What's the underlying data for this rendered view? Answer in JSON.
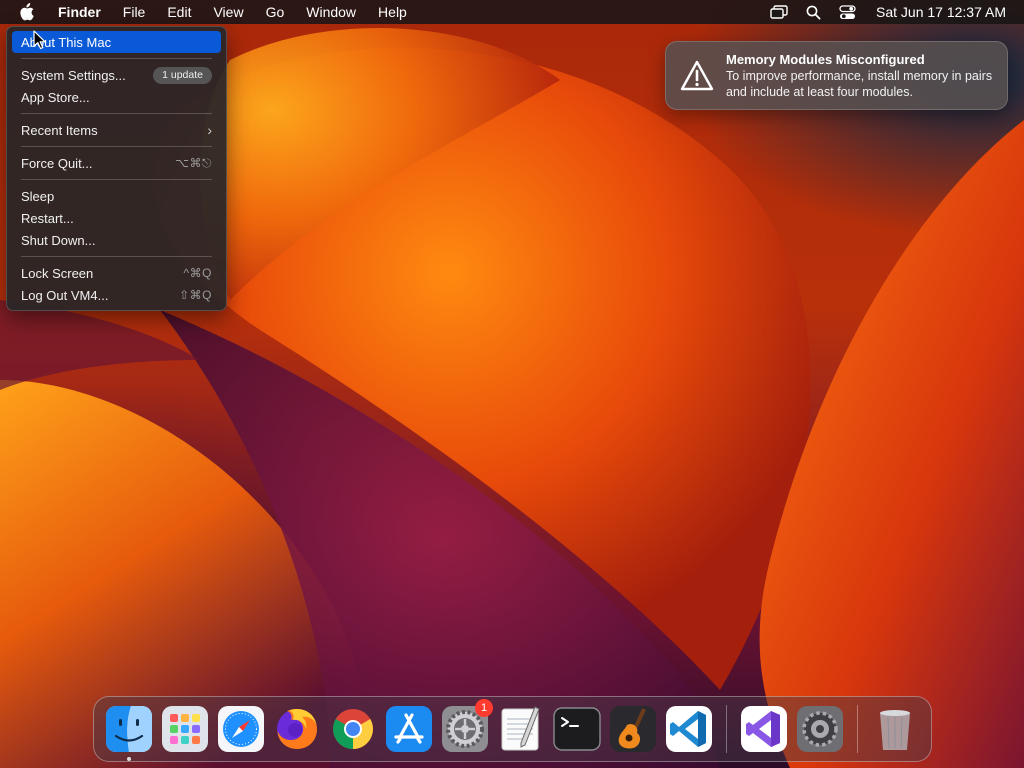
{
  "menubar": {
    "items": [
      {
        "label": "Finder"
      },
      {
        "label": "File"
      },
      {
        "label": "Edit"
      },
      {
        "label": "View"
      },
      {
        "label": "Go"
      },
      {
        "label": "Window"
      },
      {
        "label": "Help"
      }
    ],
    "status_icons": [
      "screen-mirroring-icon",
      "search-icon",
      "control-center-icon"
    ],
    "clock": "Sat Jun 17  12:37 AM"
  },
  "apple_menu": {
    "about": "About This Mac",
    "system_settings": "System Settings...",
    "update_badge": "1 update",
    "app_store": "App Store...",
    "recent_items": "Recent Items",
    "force_quit": "Force Quit...",
    "force_quit_shortcut": "⌥⌘⎋",
    "sleep": "Sleep",
    "restart": "Restart...",
    "shut_down": "Shut Down...",
    "lock_screen": "Lock Screen",
    "lock_screen_shortcut": "^⌘Q",
    "log_out": "Log Out VM4...",
    "log_out_shortcut": "⇧⌘Q"
  },
  "notification": {
    "title": "Memory Modules Misconfigured",
    "body": "To improve performance, install memory in pairs and include at least four modules.",
    "icon": "warning-icon"
  },
  "dock": {
    "apps": [
      "finder",
      "launchpad",
      "safari",
      "firefox",
      "chrome",
      "app-store",
      "system-settings",
      "textedit",
      "terminal",
      "garageband",
      "vscode"
    ],
    "recent": [
      "visual-studio",
      "settings-gear"
    ],
    "settings_badge": "1"
  },
  "colors": {
    "highlight": "#0a5ad7",
    "badge_red": "#ff3b30"
  }
}
